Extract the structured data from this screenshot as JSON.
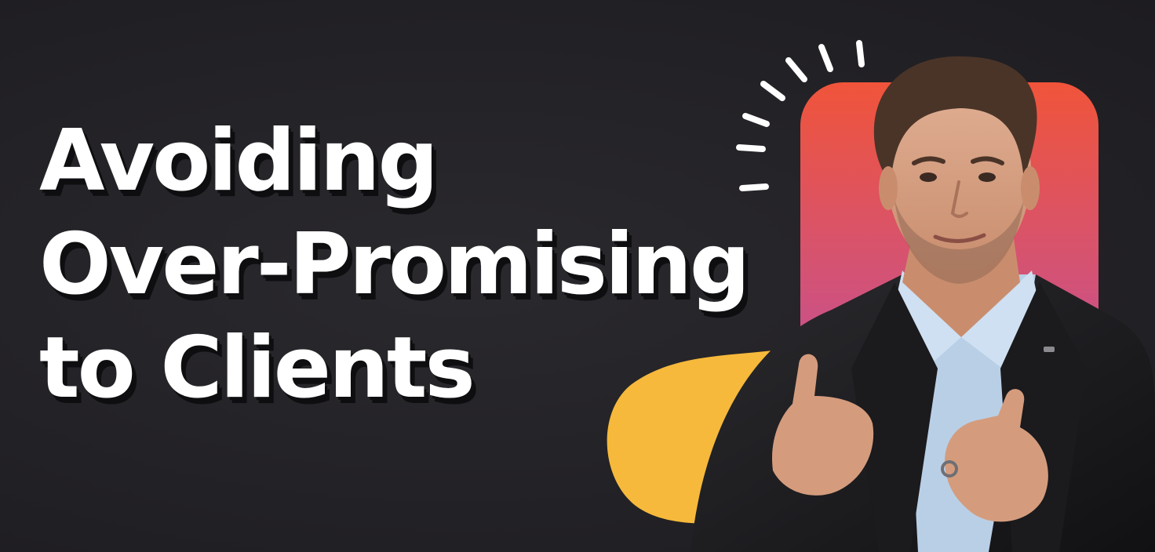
{
  "headline": {
    "line1": "Avoiding",
    "line2": "Over-Promising",
    "line3": "to Clients"
  },
  "colors": {
    "background": "#232226",
    "headline_text": "#ffffff",
    "gradient_top": "#f0543a",
    "gradient_bottom": "#8e4fd6",
    "yellow_blob": "#f6b93b",
    "burst_lines": "#ffffff"
  }
}
